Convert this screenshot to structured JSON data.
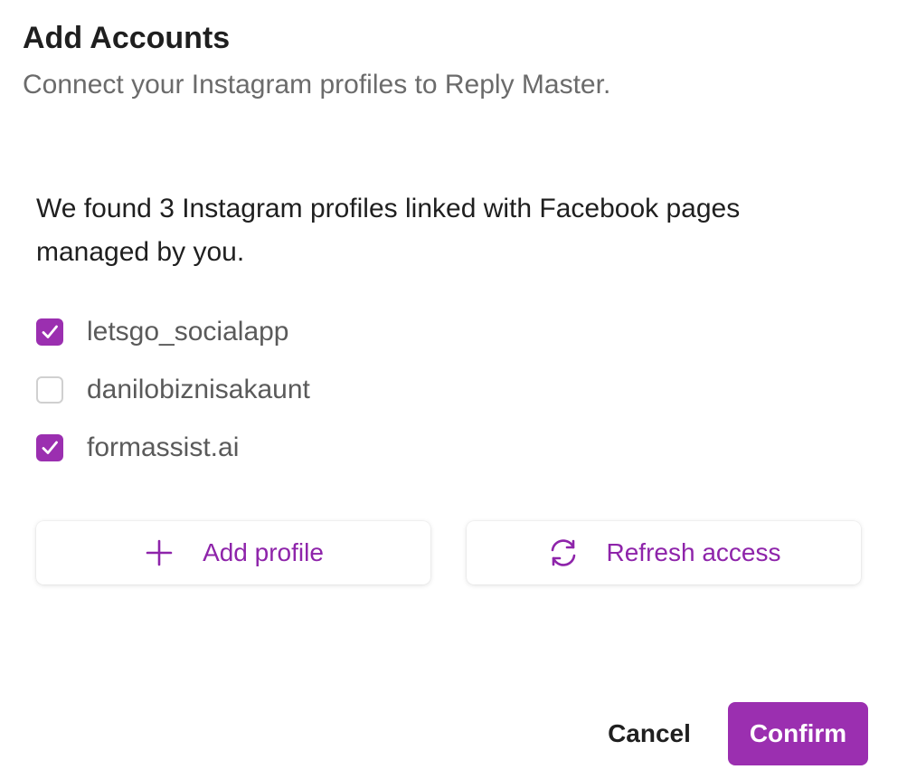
{
  "dialog": {
    "title": "Add Accounts",
    "subtitle": "Connect your Instagram profiles to Reply Master."
  },
  "found_message": "We found 3 Instagram profiles linked with Facebook pages managed by you.",
  "profiles": [
    {
      "name": "letsgo_socialapp",
      "checked": true
    },
    {
      "name": "danilobiznisakaunt",
      "checked": false
    },
    {
      "name": "formassist.ai",
      "checked": true
    }
  ],
  "actions": {
    "add_profile": {
      "label": "Add profile",
      "icon": "plus-icon"
    },
    "refresh_access": {
      "label": "Refresh access",
      "icon": "refresh-icon"
    }
  },
  "footer": {
    "cancel_label": "Cancel",
    "confirm_label": "Confirm"
  },
  "colors": {
    "accent": "#9b2fb0",
    "accent_text": "#8e24aa",
    "title": "#1f1f1f",
    "subtitle": "#6b6b6b",
    "checkbox_border": "#d0d0d0"
  }
}
